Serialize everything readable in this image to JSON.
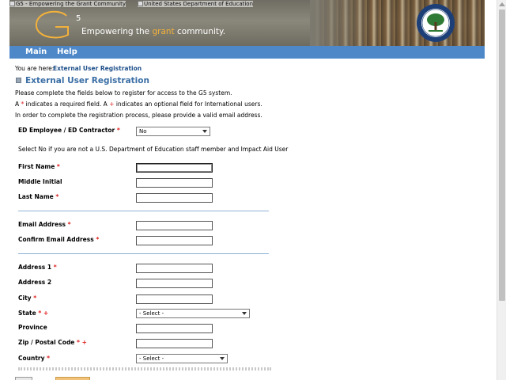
{
  "banner": {
    "alt_text_1": "G5 - Empowering the Grant Community",
    "alt_text_2": "United States Department of Education",
    "logo_text": "G",
    "logo_superscript": "5",
    "tagline_pre": "Empowering the ",
    "tagline_highlight": "grant",
    "tagline_post": " community.",
    "seal_icon": "department-of-education-seal-icon"
  },
  "nav": {
    "items": [
      {
        "label": "Main"
      },
      {
        "label": "Help"
      }
    ]
  },
  "breadcrumb": {
    "prefix": "You are here:",
    "current": "External User Registration"
  },
  "page": {
    "title": "External User Registration",
    "intro": {
      "line1": "Please complete the fields below to register for access to the G5 system.",
      "line2_a": "A ",
      "line2_star": "*",
      "line2_b": " indicates a required field. A ",
      "line2_plus": "+",
      "line2_c": " indicates an optional field for International users.",
      "line3": "In order to complete the registration process, please provide a valid email address."
    }
  },
  "form": {
    "ed_employee": {
      "label": "ED Employee / ED Contractor",
      "required": "*",
      "value": "No"
    },
    "helper_text": "Select No if you are not a U.S. Department of Education staff member and Impact Aid User",
    "first_name": {
      "label": "First Name",
      "required": "*",
      "value": ""
    },
    "middle_initial": {
      "label": "Middle Initial",
      "value": ""
    },
    "last_name": {
      "label": "Last Name",
      "required": "*",
      "value": ""
    },
    "email": {
      "label": "Email Address",
      "required": "*",
      "value": ""
    },
    "confirm_email": {
      "label": "Confirm Email Address",
      "required": "*",
      "value": ""
    },
    "address1": {
      "label": "Address 1",
      "required": "*",
      "value": ""
    },
    "address2": {
      "label": "Address 2",
      "value": ""
    },
    "city": {
      "label": "City",
      "required": "*",
      "value": ""
    },
    "state": {
      "label": "State",
      "required": "*",
      "intl": "+",
      "value": "- Select -"
    },
    "province": {
      "label": "Province",
      "value": ""
    },
    "zip": {
      "label": "Zip / Postal Code",
      "required": "*",
      "intl": "+",
      "value": ""
    },
    "country": {
      "label": "Country",
      "required": "*",
      "value": "- Select -"
    }
  },
  "colors": {
    "nav_bar": "#4e88c8",
    "title": "#3a6ea5",
    "required_marker": "#e02020",
    "tagline_highlight": "#f3b23a"
  }
}
